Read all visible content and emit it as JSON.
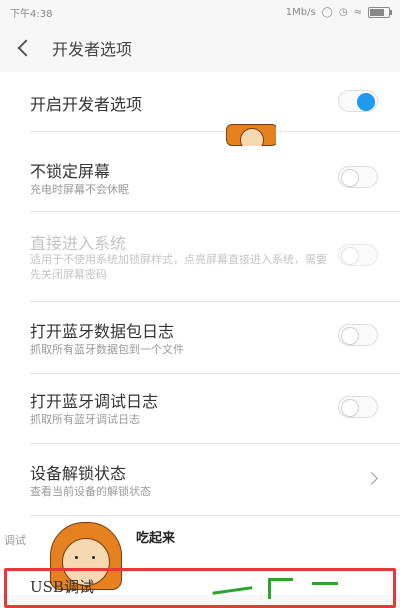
{
  "status_bar": {
    "time": "下午4:38",
    "net_speed": "1Mb/s"
  },
  "header": {
    "title": "开发者选项"
  },
  "settings": [
    {
      "title": "开启开发者选项",
      "toggle": "on"
    },
    {
      "title": "不锁定屏幕",
      "subtitle": "充电时屏幕不会休眠",
      "toggle": "off"
    },
    {
      "title": "直接进入系统",
      "subtitle": "适用于不使用系统加锁屏样式，点亮屏幕直接进入系统，需要先关闭屏幕密码",
      "toggle": "off",
      "disabled": true
    },
    {
      "title": "打开蓝牙数据包日志",
      "subtitle": "抓取所有蓝牙数据包到一个文件",
      "toggle": "off"
    },
    {
      "title": "打开蓝牙调试日志",
      "subtitle": "抓取所有蓝牙调试日志",
      "toggle": "off"
    },
    {
      "title": "设备解锁状态",
      "subtitle": "查看当前设备的解锁状态",
      "chevron": true
    }
  ],
  "section": {
    "label": "调试",
    "overlay_text": "吃起来"
  },
  "usb_debug": {
    "title": "USB调试"
  },
  "accent": "#1e9bf0",
  "highlight": "#e53935"
}
